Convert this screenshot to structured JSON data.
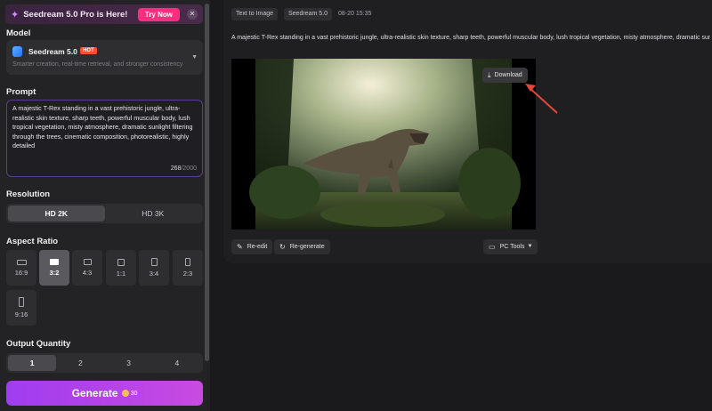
{
  "promo": {
    "text": "Seedream 5.0 Pro is Here!",
    "cta": "Try Now",
    "close": "✕"
  },
  "model": {
    "section_label": "Model",
    "name": "Seedream 5.0",
    "badge": "HOT",
    "description": "Smarter creation, real-time retrieval, and stronger consistency"
  },
  "prompt": {
    "section_label": "Prompt",
    "text": "A majestic T-Rex standing in a vast prehistoric jungle, ultra-realistic skin texture, sharp teeth, powerful muscular body, lush tropical vegetation, misty atmosphere, dramatic sunlight filtering through the trees, cinematic composition, photorealistic, highly detailed",
    "count": "268",
    "max": "/2000"
  },
  "resolution": {
    "section_label": "Resolution",
    "options": [
      "HD 2K",
      "HD 3K"
    ],
    "selected": "HD 2K"
  },
  "aspect": {
    "section_label": "Aspect Ratio",
    "options": [
      "16:9",
      "3:2",
      "4:3",
      "1:1",
      "3:4",
      "2:3",
      "9:16"
    ],
    "selected": "3:2"
  },
  "quantity": {
    "section_label": "Output Quantity",
    "options": [
      "1",
      "2",
      "3",
      "4"
    ],
    "selected": "1"
  },
  "generate": {
    "label": "Generate",
    "cost": "30"
  },
  "result": {
    "tag_mode": "Text to Image",
    "tag_model": "Seedream 5.0",
    "timestamp": "08-20 15:35",
    "prompt": "A majestic T-Rex standing in a vast prehistoric jungle, ultra-realistic skin texture, sharp teeth, powerful muscular body, lush tropical vegetation, misty atmosphere, dramatic sunlight filtering through the trees, cinematic composition, photorealistic, highly detailed",
    "download": "Download",
    "reedit": "Re-edit",
    "regenerate": "Re-generate",
    "pc_tools": "PC Tools"
  },
  "colors": {
    "accent": "#a43ef0",
    "arrow": "#e2483a",
    "hot": "#ff4d2d"
  }
}
